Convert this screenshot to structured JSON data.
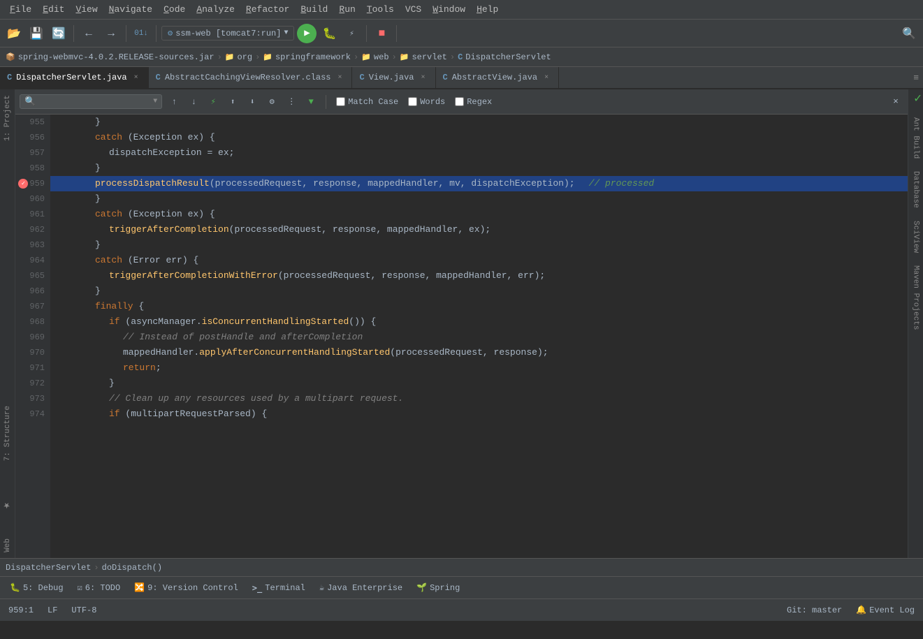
{
  "menu": {
    "items": [
      "File",
      "Edit",
      "View",
      "Navigate",
      "Code",
      "Analyze",
      "Refactor",
      "Build",
      "Run",
      "Tools",
      "VCS",
      "Window",
      "Help"
    ]
  },
  "toolbar": {
    "run_config": "ssm-web [tomcat7:run]"
  },
  "breadcrumb": {
    "items": [
      "spring-webmvc-4.0.2.RELEASE-sources.jar",
      "org",
      "springframework",
      "web",
      "servlet",
      "DispatcherServlet"
    ]
  },
  "tabs": [
    {
      "label": "DispatcherServlet.java",
      "active": true,
      "icon": "C"
    },
    {
      "label": "AbstractCachingViewResolver.class",
      "active": false,
      "icon": "C"
    },
    {
      "label": "View.java",
      "active": false,
      "icon": "C"
    },
    {
      "label": "AbstractView.java",
      "active": false,
      "icon": "C"
    }
  ],
  "search": {
    "placeholder": "",
    "match_case": "Match Case",
    "words": "Words",
    "regex": "Regex"
  },
  "code": {
    "lines": [
      {
        "num": 955,
        "indent": 3,
        "text": "}"
      },
      {
        "num": 956,
        "indent": 3,
        "text": "catch (Exception ex) {"
      },
      {
        "num": 957,
        "indent": 4,
        "text": "dispatchException = ex;"
      },
      {
        "num": 958,
        "indent": 3,
        "text": "}"
      },
      {
        "num": 959,
        "indent": 3,
        "text": "processDispatchResult(processedRequest, response, mappedHandler, mv, dispatchException);",
        "highlighted": true,
        "has_bookmark": true
      },
      {
        "num": 960,
        "indent": 3,
        "text": "}"
      },
      {
        "num": 961,
        "indent": 3,
        "text": "catch (Exception ex) {"
      },
      {
        "num": 962,
        "indent": 4,
        "text": "triggerAfterCompletion(processedRequest, response, mappedHandler, ex);"
      },
      {
        "num": 963,
        "indent": 3,
        "text": "}"
      },
      {
        "num": 964,
        "indent": 3,
        "text": "catch (Error err) {"
      },
      {
        "num": 965,
        "indent": 4,
        "text": "triggerAfterCompletionWithError(processedRequest, response, mappedHandler, err);"
      },
      {
        "num": 966,
        "indent": 3,
        "text": "}"
      },
      {
        "num": 967,
        "indent": 3,
        "text": "finally {"
      },
      {
        "num": 968,
        "indent": 4,
        "text": "if (asyncManager.isConcurrentHandlingStarted()) {"
      },
      {
        "num": 969,
        "indent": 5,
        "text": "// Instead of postHandle and afterCompletion"
      },
      {
        "num": 970,
        "indent": 5,
        "text": "mappedHandler.applyAfterConcurrentHandlingStarted(processedRequest, response);"
      },
      {
        "num": 971,
        "indent": 5,
        "text": "return;"
      },
      {
        "num": 972,
        "indent": 4,
        "text": "}"
      },
      {
        "num": 973,
        "indent": 4,
        "text": "// Clean up any resources used by a multipart request."
      },
      {
        "num": 974,
        "indent": 4,
        "text": "if (multipartRequestParsed) {"
      }
    ]
  },
  "right_sidebar": {
    "tabs": [
      "Ant Build",
      "Database",
      "SciView",
      "Maven Projects"
    ]
  },
  "left_sidebar": {
    "tabs": [
      "1: Project",
      "2: Favorites",
      "Web"
    ]
  },
  "left_tabs_bottom": {
    "tabs": [
      "7: Structure"
    ]
  },
  "breadcrumb_bottom": {
    "class_name": "DispatcherServlet",
    "method": "doDispatch()"
  },
  "bottom_tools": [
    {
      "num": "5",
      "label": "Debug",
      "icon": "🐛"
    },
    {
      "num": "6",
      "label": "TODO",
      "icon": "☑"
    },
    {
      "num": "9",
      "label": "Version Control",
      "icon": "🔀"
    },
    {
      "label": "Terminal",
      "icon": ">"
    },
    {
      "label": "Java Enterprise",
      "icon": "☕"
    },
    {
      "label": "Spring",
      "icon": "🌱"
    }
  ],
  "status": {
    "line": "959:1",
    "lf": "LF",
    "encoding": "UTF-8",
    "git": "Git: master",
    "event_log": "Event Log"
  }
}
